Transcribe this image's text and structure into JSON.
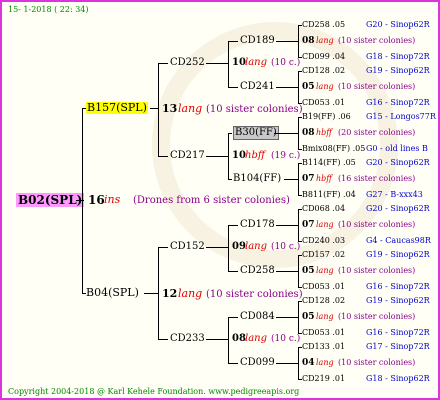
{
  "date": "15- 1-2018 ( 22: 34)",
  "footer": "Copyright 2004-2018 @ Karl Kehele Foundation.   www.pedigreeapis.org",
  "root": {
    "name": "B02(SPL)",
    "num": "16",
    "ins": "ins",
    "note": "(Drones from 6 sister colonies)"
  },
  "sire": {
    "name": "B157(SPL)",
    "num": "13",
    "lang": "lang",
    "note": "(10 sister colonies)"
  },
  "dam": {
    "name": "B04(SPL)",
    "num": "12",
    "lang": "lang",
    "note": "(10 sister colonies)"
  },
  "g2": [
    {
      "name": "CD252",
      "num": "10",
      "lang": "lang",
      "note": "(10 c.)"
    },
    {
      "name": "CD217",
      "num": "10",
      "lang": "hbff",
      "note": "(19 c.)"
    },
    {
      "name": "CD152",
      "num": "09",
      "lang": "lang",
      "note": "(10 c.)"
    },
    {
      "name": "CD233",
      "num": "08",
      "lang": "lang",
      "note": "(10 c.)"
    }
  ],
  "g3": [
    {
      "name": "CD189"
    },
    {
      "name": "CD241"
    },
    {
      "name": "B30(FF)"
    },
    {
      "name": "B104(FF)"
    },
    {
      "name": "CD178"
    },
    {
      "name": "CD258"
    },
    {
      "name": "CD084"
    },
    {
      "name": "CD099"
    }
  ],
  "g4": [
    {
      "top": "CD258 .05",
      "topr": "G20 - Sinop62R",
      "num": "08",
      "lang": "lang",
      "note": "(10 sister colonies)",
      "bot": "CD099 .04",
      "botr": "G18 - Sinop72R"
    },
    {
      "top": "CD128 .02",
      "topr": "G19 - Sinop62R",
      "num": "05",
      "lang": "lang",
      "note": "(10 sister colonies)",
      "bot": "CD053 .01",
      "botr": "G16 - Sinop72R"
    },
    {
      "top": "B19(FF) .06",
      "topr": "G15 - Longos77R",
      "num": "08",
      "lang": "hbff",
      "note": "(20 sister colonies)",
      "bot": "Bmix08(FF) .05",
      "botr": "G0 - old lines B"
    },
    {
      "top": "B114(FF) .05",
      "topr": "G20 - Sinop62R",
      "num": "07",
      "lang": "hbff",
      "note": "(16 sister colonies)",
      "bot": "B811(FF) .04",
      "botr": "G27 - B-xxx43"
    },
    {
      "top": "CD068 .04",
      "topr": "G20 - Sinop62R",
      "num": "07",
      "lang": "lang",
      "note": "(10 sister colonies)",
      "bot": "CD240 .03",
      "botr": "G4 - Caucas98R"
    },
    {
      "top": "CD157 .02",
      "topr": "G19 - Sinop62R",
      "num": "05",
      "lang": "lang",
      "note": "(10 sister colonies)",
      "bot": "CD053 .01",
      "botr": "G16 - Sinop72R"
    },
    {
      "top": "CD128 .02",
      "topr": "G19 - Sinop62R",
      "num": "05",
      "lang": "lang",
      "note": "(10 sister colonies)",
      "bot": "CD053 .01",
      "botr": "G16 - Sinop72R"
    },
    {
      "top": "CD133 .01",
      "topr": "G17 - Sinop72R",
      "num": "04",
      "lang": "lang",
      "note": "(10 sister colonies)",
      "bot": "CD219 .01",
      "botr": "G18 - Sinop62R"
    }
  ]
}
